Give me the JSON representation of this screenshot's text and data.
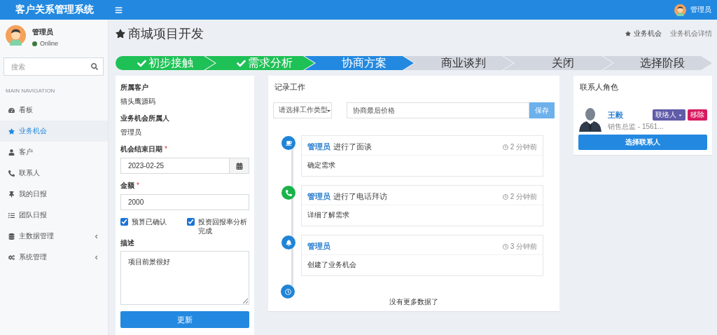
{
  "header": {
    "title": "客户关系管理系统",
    "user": "管理员"
  },
  "sidebar": {
    "user": {
      "name": "管理员",
      "status": "Online"
    },
    "search": {
      "placeholder": "搜索"
    },
    "section": "MAIN NAVIGATION",
    "items": [
      {
        "label": "看板",
        "selected": false,
        "submenu": false
      },
      {
        "label": "业务机会",
        "selected": true,
        "submenu": false
      },
      {
        "label": "客户",
        "selected": false,
        "submenu": false
      },
      {
        "label": "联系人",
        "selected": false,
        "submenu": false
      },
      {
        "label": "我的日报",
        "selected": false,
        "submenu": false
      },
      {
        "label": "团队日报",
        "selected": false,
        "submenu": false
      },
      {
        "label": "主数据管理",
        "selected": false,
        "submenu": true
      },
      {
        "label": "系统管理",
        "selected": false,
        "submenu": true
      }
    ]
  },
  "page": {
    "title": "商城项目开发",
    "breadcrumb": [
      "业务机会",
      "业务机会详情"
    ]
  },
  "stages": [
    {
      "label": "初步接触",
      "completed": true,
      "selected": false
    },
    {
      "label": "需求分析",
      "completed": true,
      "selected": false
    },
    {
      "label": "协商方案",
      "completed": false,
      "selected": true
    },
    {
      "label": "商业谈判",
      "completed": false,
      "selected": false
    },
    {
      "label": "关闭",
      "completed": false,
      "selected": false
    },
    {
      "label": "选择阶段",
      "completed": false,
      "selected": false
    }
  ],
  "details": {
    "fields": [
      {
        "kind": "text",
        "label": "所属客户",
        "value": "猫头鹰源码"
      },
      {
        "kind": "text",
        "label": "业务机会所属人",
        "value": "管理员"
      },
      {
        "kind": "date",
        "label": "机会结束日期",
        "required_mark": "*",
        "value": "2023-02-25"
      },
      {
        "kind": "input",
        "label": "金额",
        "required_mark": "*",
        "value": "2000"
      }
    ],
    "checks": [
      {
        "label": "预算已确认",
        "checked": true
      },
      {
        "label": "投资回报率分析完成",
        "checked": true
      }
    ],
    "description": {
      "label": "描述",
      "value": "项目前景很好"
    },
    "submit": "更新"
  },
  "worklog": {
    "title": "记录工作",
    "type_select": {
      "placeholder": "请选择工作类型"
    },
    "note": {
      "value": "协商最后价格"
    },
    "save": "保存",
    "entries": [
      {
        "kind": "meeting",
        "color": "#1f84d6",
        "user": "管理员",
        "action": "进行了面谈",
        "time": "2 分钟前",
        "body": "确定需求"
      },
      {
        "kind": "call",
        "color": "#19b34a",
        "user": "管理员",
        "action": "进行了电话拜访",
        "time": "2 分钟前",
        "body": "详细了解需求"
      },
      {
        "kind": "created",
        "color": "#1f84d6",
        "user": "管理员",
        "time": "3 分钟前",
        "body": "创建了业务机会"
      }
    ],
    "footer": "没有更多数据了"
  },
  "contacts": {
    "title": "联系人角色",
    "items": [
      {
        "name": "王毅",
        "subtitle": "销售总监 - 1561...",
        "role": "联络人",
        "remove": "移除"
      }
    ],
    "choose": "选择联系人"
  }
}
